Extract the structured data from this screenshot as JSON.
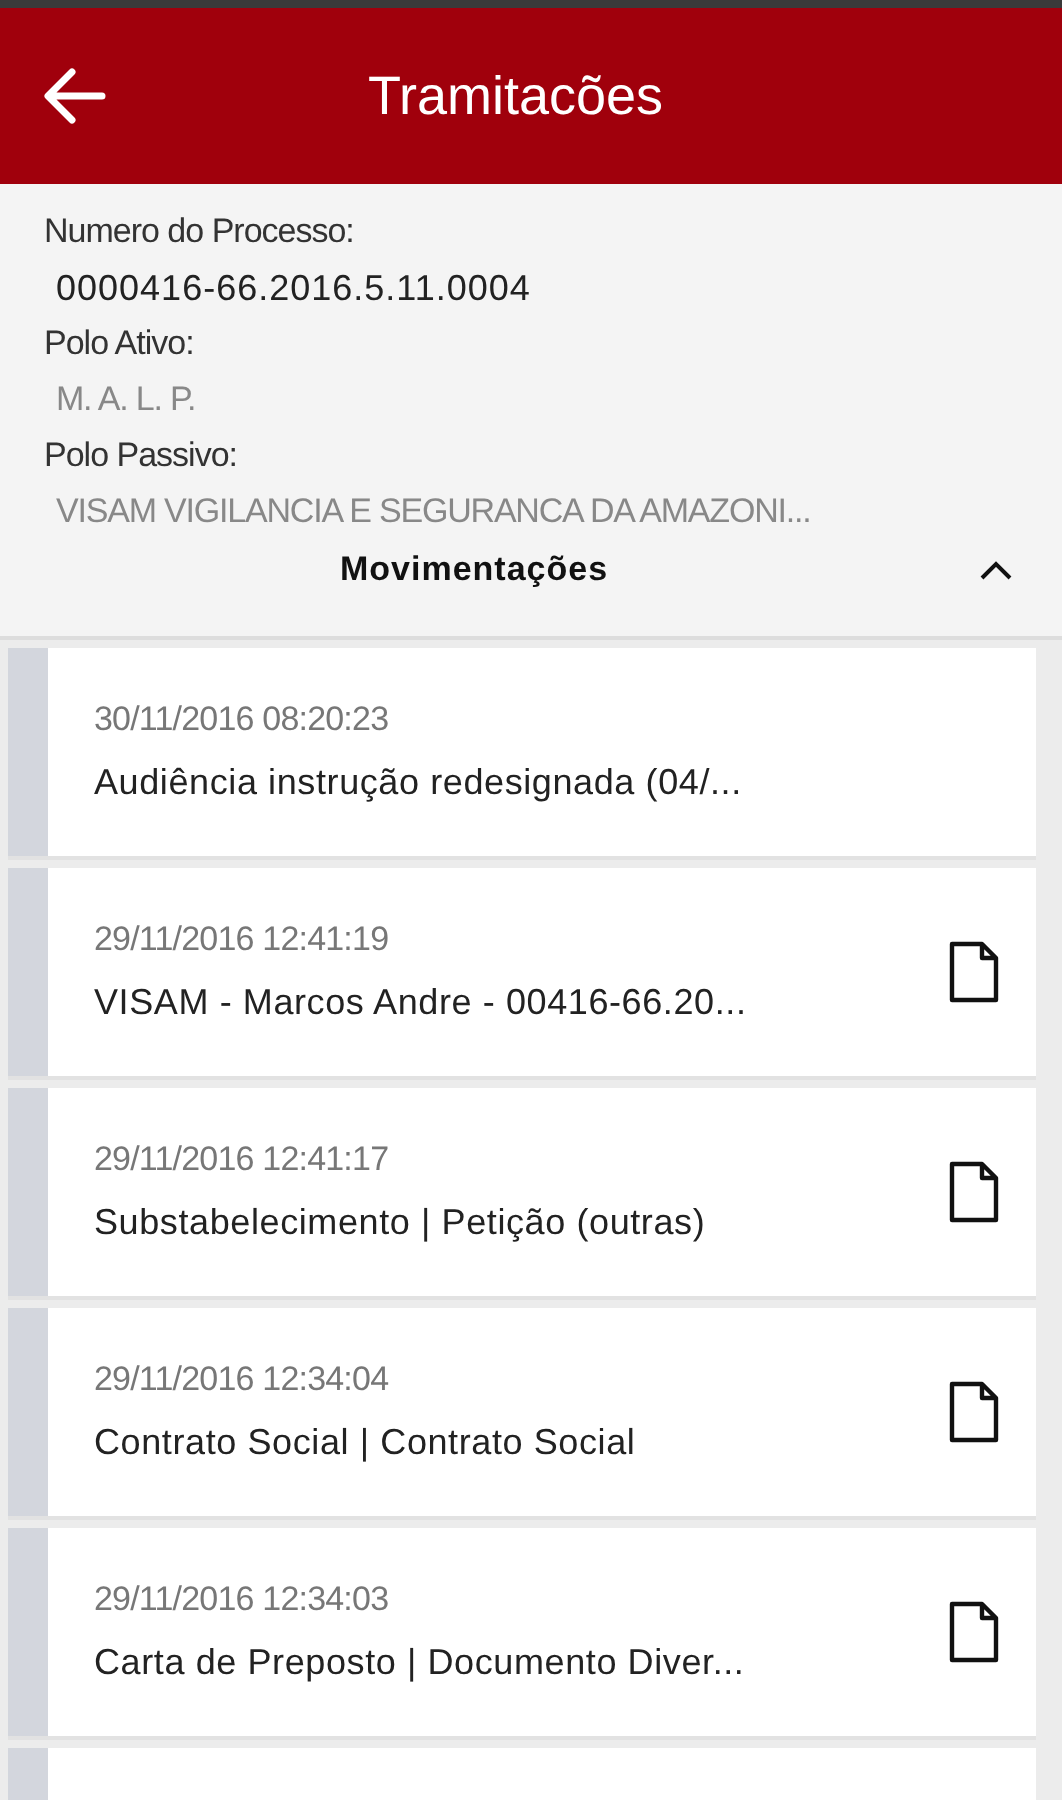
{
  "header": {
    "title": "Tramitacões"
  },
  "process": {
    "fields": [
      {
        "label": "Numero do Processo:",
        "value": "0000416-66.2016.5.11.0004",
        "kind": "number"
      },
      {
        "label": "Polo Ativo:",
        "value": "M. A. L. P.",
        "kind": "party"
      },
      {
        "label": "Polo Passivo:",
        "value": "VISAM VIGILANCIA E SEGURANCA DA AMAZONI...",
        "kind": "party"
      }
    ]
  },
  "section": {
    "title": "Movimentações",
    "expanded": true
  },
  "movements": [
    {
      "date": "30/11/2016 08:20:23",
      "description": "Audiência instrução redesignada (04/...",
      "document": false
    },
    {
      "date": "29/11/2016 12:41:19",
      "description": "VISAM - Marcos Andre - 00416-66.20...",
      "document": true
    },
    {
      "date": "29/11/2016 12:41:17",
      "description": "Substabelecimento | Petição (outras)",
      "document": true
    },
    {
      "date": "29/11/2016 12:34:04",
      "description": "Contrato Social | Contrato Social",
      "document": true
    },
    {
      "date": "29/11/2016 12:34:03",
      "description": "Carta de Preposto | Documento Diver...",
      "document": true
    }
  ]
}
